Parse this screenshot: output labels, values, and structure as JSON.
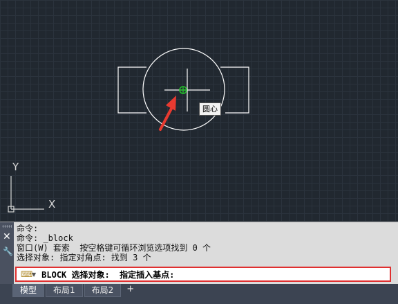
{
  "canvas": {
    "tooltip": "圆心",
    "ucs": {
      "x_label": "X",
      "y_label": "Y"
    }
  },
  "command_panel": {
    "history": [
      "命令:",
      "命令: _block",
      "窗口(W) 套索  按空格键可循环浏览选项找到 0 个",
      "选择对象: 指定对角点: 找到 3 个"
    ],
    "prompt": "BLOCK 选择对象:  指定插入基点:"
  },
  "layout_tabs": [
    "模型",
    "布局1",
    "布局2"
  ],
  "colors": {
    "background": "#212830",
    "geometry": "#ffffff",
    "snap_marker": "#22c02a",
    "annotation": "#e83a30"
  }
}
